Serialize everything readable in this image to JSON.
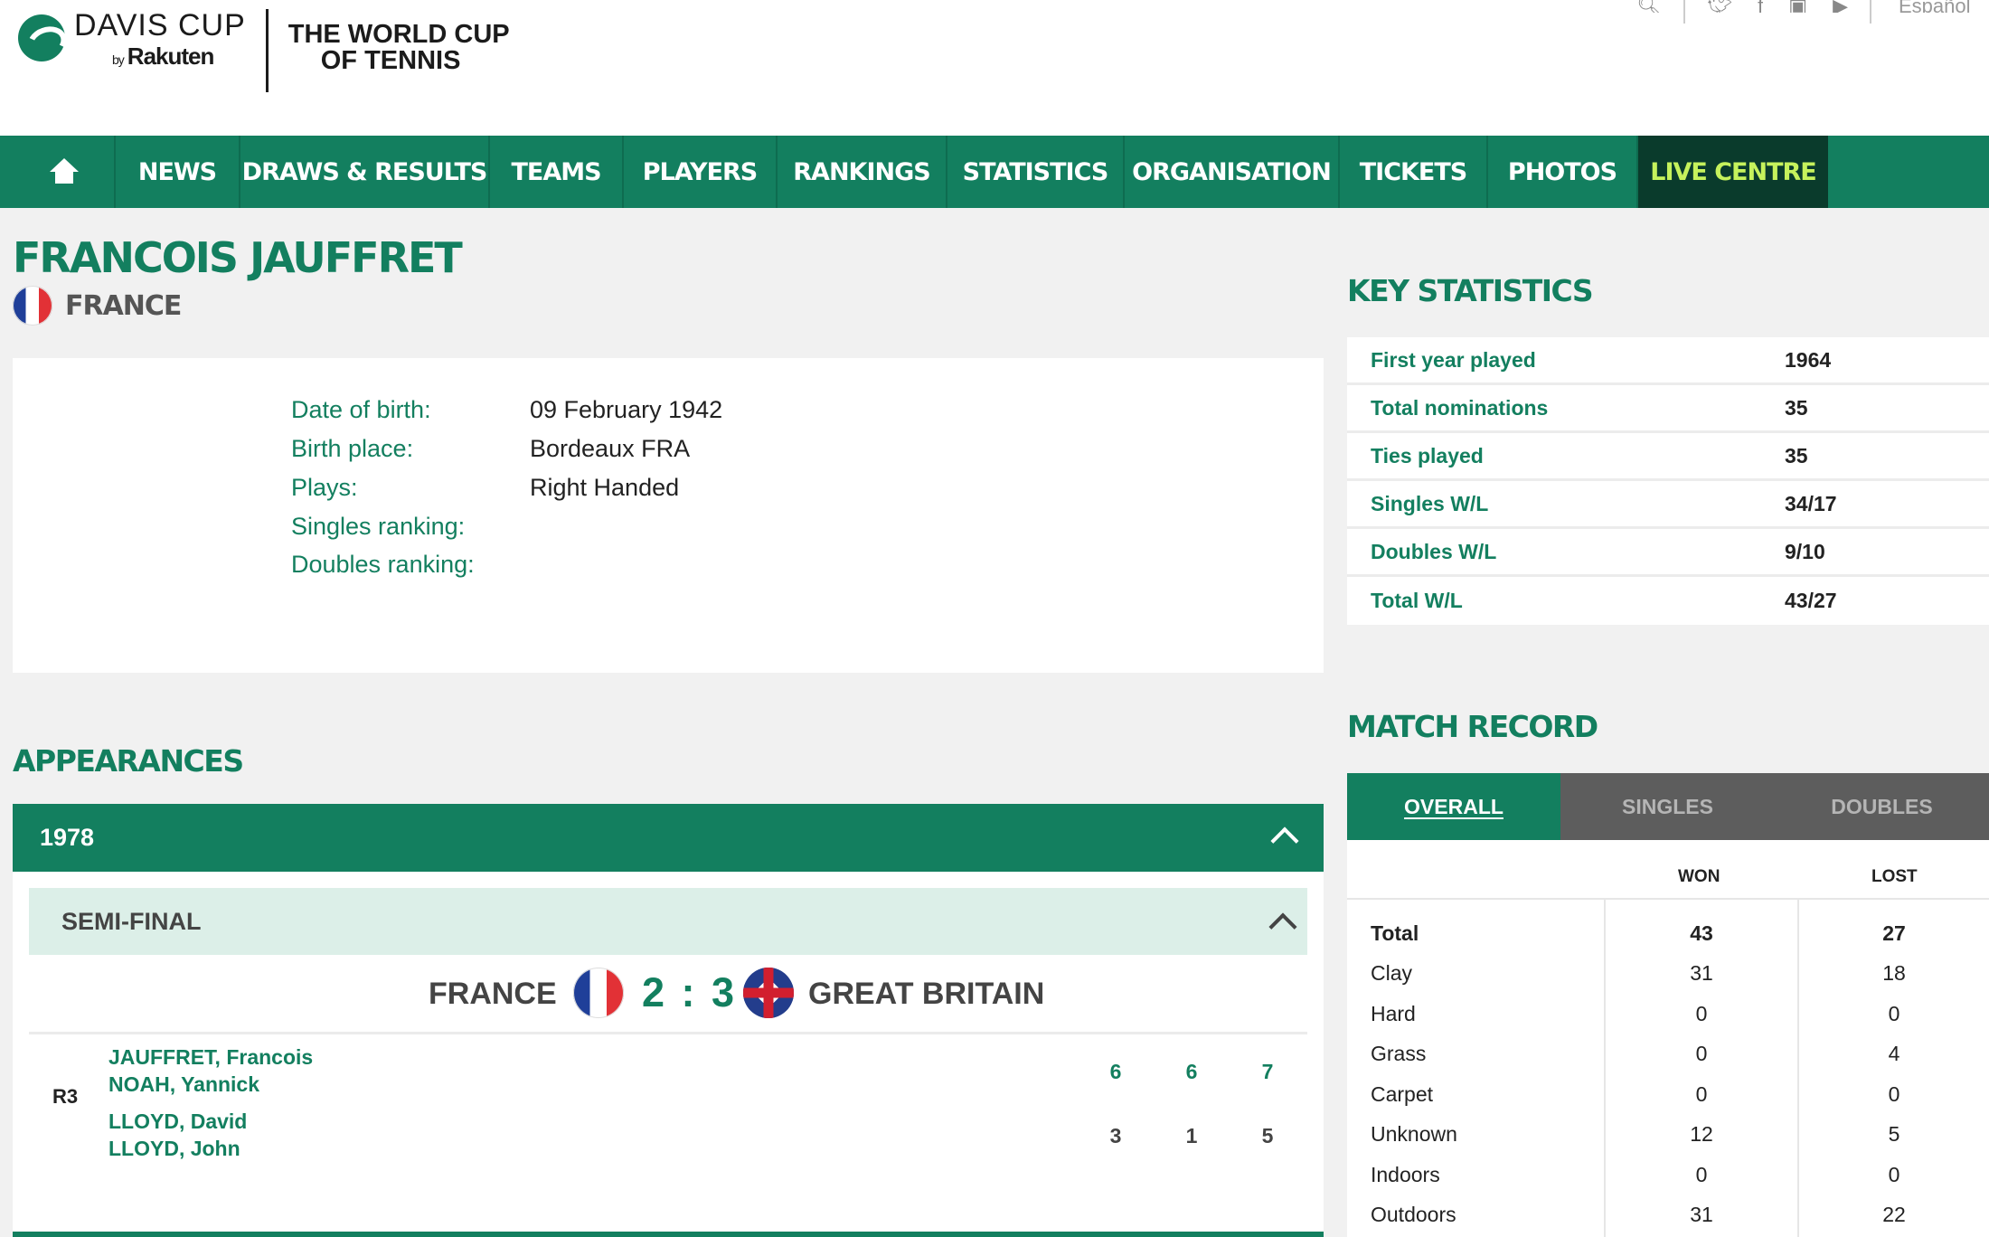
{
  "header": {
    "brand": "DAVIS CUP",
    "brand_by": "by",
    "brand_sponsor": "Rakuten",
    "tagline_line1": "THE WORLD CUP",
    "tagline_line2": "OF TENNIS",
    "language": "Español"
  },
  "nav": {
    "items": [
      "NEWS",
      "DRAWS & RESULTS",
      "TEAMS",
      "PLAYERS",
      "RANKINGS",
      "STATISTICS",
      "ORGANISATION",
      "TICKETS",
      "PHOTOS",
      "LIVE CENTRE"
    ]
  },
  "player": {
    "name": "FRANCOIS JAUFFRET",
    "country": "FRANCE"
  },
  "bio": {
    "rows": [
      {
        "label": "Date of birth:",
        "value": "09 February 1942"
      },
      {
        "label": "Birth place:",
        "value": "Bordeaux FRA"
      },
      {
        "label": "Plays:",
        "value": "Right Handed"
      },
      {
        "label": "Singles ranking:",
        "value": ""
      },
      {
        "label": "Doubles ranking:",
        "value": ""
      }
    ]
  },
  "appearances": {
    "title": "APPEARANCES",
    "year": "1978",
    "round": "SEMI-FINAL",
    "tie": {
      "home_team": "FRANCE",
      "score": "2 : 3",
      "away_team": "GREAT BRITAIN"
    },
    "rubber": {
      "round": "R3",
      "team1": [
        "JAUFFRET, Francois",
        "NOAH, Yannick"
      ],
      "team2": [
        "LLOYD, David",
        "LLOYD, John"
      ],
      "sets_team1": [
        "6",
        "6",
        "7"
      ],
      "sets_team2": [
        "3",
        "1",
        "5"
      ]
    }
  },
  "key_statistics": {
    "title": "KEY STATISTICS",
    "rows": [
      {
        "label": "First year played",
        "value": "1964"
      },
      {
        "label": "Total nominations",
        "value": "35"
      },
      {
        "label": "Ties played",
        "value": "35"
      },
      {
        "label": "Singles W/L",
        "value": "34/17"
      },
      {
        "label": "Doubles W/L",
        "value": "9/10"
      },
      {
        "label": "Total W/L",
        "value": "43/27"
      }
    ]
  },
  "match_record": {
    "title": "MATCH RECORD",
    "tabs": [
      "OVERALL",
      "SINGLES",
      "DOUBLES"
    ],
    "active_tab": "OVERALL",
    "col_won": "WON",
    "col_lost": "LOST",
    "rows": [
      {
        "label": "Total",
        "won": "43",
        "lost": "27"
      },
      {
        "label": "Clay",
        "won": "31",
        "lost": "18"
      },
      {
        "label": "Hard",
        "won": "0",
        "lost": "0"
      },
      {
        "label": "Grass",
        "won": "0",
        "lost": "4"
      },
      {
        "label": "Carpet",
        "won": "0",
        "lost": "0"
      },
      {
        "label": "Unknown",
        "won": "12",
        "lost": "5"
      },
      {
        "label": "Indoors",
        "won": "0",
        "lost": "0"
      },
      {
        "label": "Outdoors",
        "won": "31",
        "lost": "22"
      }
    ]
  },
  "icons": {
    "home": "home-icon",
    "search": "search-icon",
    "twitter": "twitter-icon",
    "facebook": "facebook-icon",
    "instagram": "instagram-icon",
    "youtube": "youtube-icon",
    "collapse": "chevron-up-icon"
  },
  "colors": {
    "brand_green": "#137f5f",
    "live_bg": "#0a3b2c",
    "live_text": "#c6f25c",
    "round_bg": "#dcefe8",
    "inactive_tab": "#5d5d5d"
  }
}
